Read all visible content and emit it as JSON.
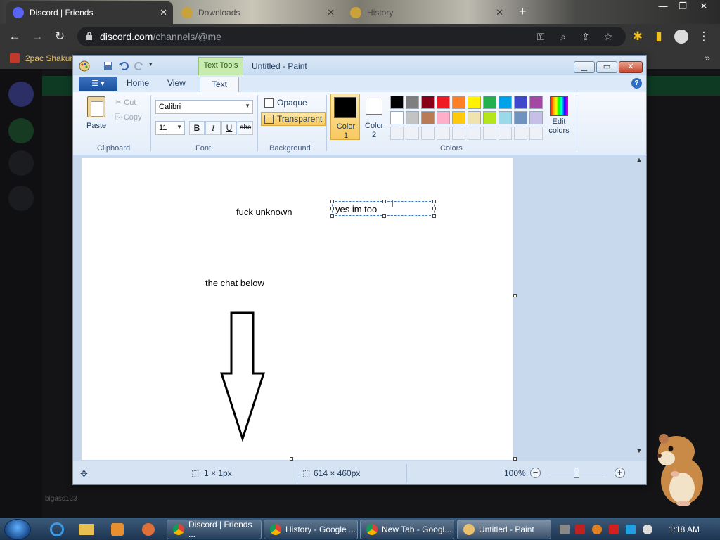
{
  "browser": {
    "tabs": [
      {
        "title": "Discord | Friends",
        "active": true
      },
      {
        "title": "Downloads",
        "active": false
      },
      {
        "title": "History",
        "active": false
      }
    ],
    "url_domain": "discord.com",
    "url_path": "/channels/@me",
    "bookmark": "2pac Shakur"
  },
  "paint": {
    "title": "Untitled - Paint",
    "context_tab": "Text Tools",
    "tabs": {
      "home": "Home",
      "view": "View",
      "text": "Text"
    },
    "clipboard": {
      "paste": "Paste",
      "cut": "Cut",
      "copy": "Copy",
      "group": "Clipboard"
    },
    "font": {
      "family": "Calibri",
      "size": "11",
      "bold": "B",
      "italic": "I",
      "underline": "U",
      "strike": "abc",
      "group": "Font"
    },
    "background": {
      "opaque": "Opaque",
      "transparent": "Transparent",
      "group": "Background",
      "selected": "Transparent"
    },
    "colors": {
      "color1_label": "Color 1",
      "color2_label": "Color 2",
      "edit_label": "Edit colors",
      "group": "Colors",
      "color1": "#000000",
      "color2": "#ffffff",
      "row1": [
        "#000000",
        "#7f7f7f",
        "#880015",
        "#ed1c24",
        "#ff7f27",
        "#fff200",
        "#22b14c",
        "#00a2e8",
        "#3f48cc",
        "#a349a4"
      ],
      "row2": [
        "#ffffff",
        "#c3c3c3",
        "#b97a57",
        "#ffaec9",
        "#ffc90e",
        "#efe4b0",
        "#b5e61d",
        "#99d9ea",
        "#7092be",
        "#c8bfe7"
      ]
    },
    "canvas_texts": {
      "text1": "fuck unknown",
      "text2": "yes im too",
      "text3": "the chat below"
    },
    "status": {
      "cursor": "1 × 1px",
      "canvas_size": "614 × 460px",
      "zoom": "100%"
    }
  },
  "taskbar": {
    "apps": [
      {
        "label": "Discord | Friends ...",
        "active": false
      },
      {
        "label": "History - Google ...",
        "active": false
      },
      {
        "label": "New Tab - Googl...",
        "active": false
      },
      {
        "label": "Untitled - Paint",
        "active": true
      }
    ],
    "clock": "1:18 AM"
  },
  "discord": {
    "user": "bigass123"
  }
}
